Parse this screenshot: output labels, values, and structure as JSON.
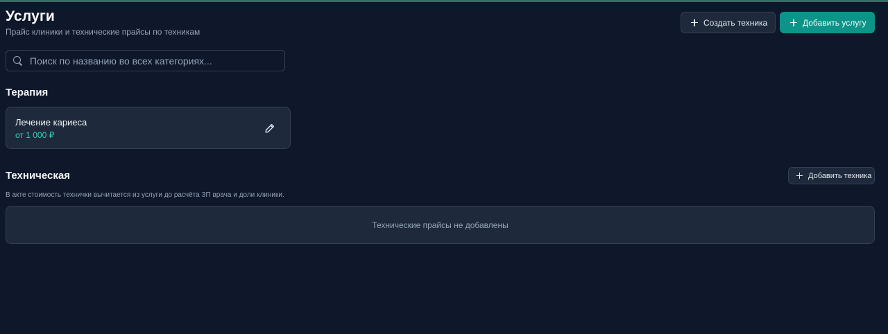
{
  "header": {
    "title": "Услуги",
    "subtitle": "Прайс клиники и технические прайсы по техникам"
  },
  "actions": {
    "create_tech_label": "Создать техника",
    "add_service_label": "Добавить услугу"
  },
  "search": {
    "placeholder": "Поиск по названию во всех категориях...",
    "value": ""
  },
  "categories": [
    {
      "title": "Терапия",
      "services": [
        {
          "name": "Лечение кариеса",
          "price": "от 1 000 ₽"
        }
      ]
    },
    {
      "title": "Техническая",
      "add_label": "Добавить техника",
      "note": "В акте стоимость технички вычитается из услуги до расчёта ЗП врача и доли клиники.",
      "empty_text": "Технические прайсы не добавлены"
    }
  ],
  "colors": {
    "background": "#0f172a",
    "card": "#1e293b",
    "accent": "#0d9488",
    "price": "#2dd4bf",
    "top_accent": "#2f6f64"
  },
  "icons": {
    "plus": "plus-icon",
    "search": "search-icon",
    "edit": "pencil-icon"
  }
}
